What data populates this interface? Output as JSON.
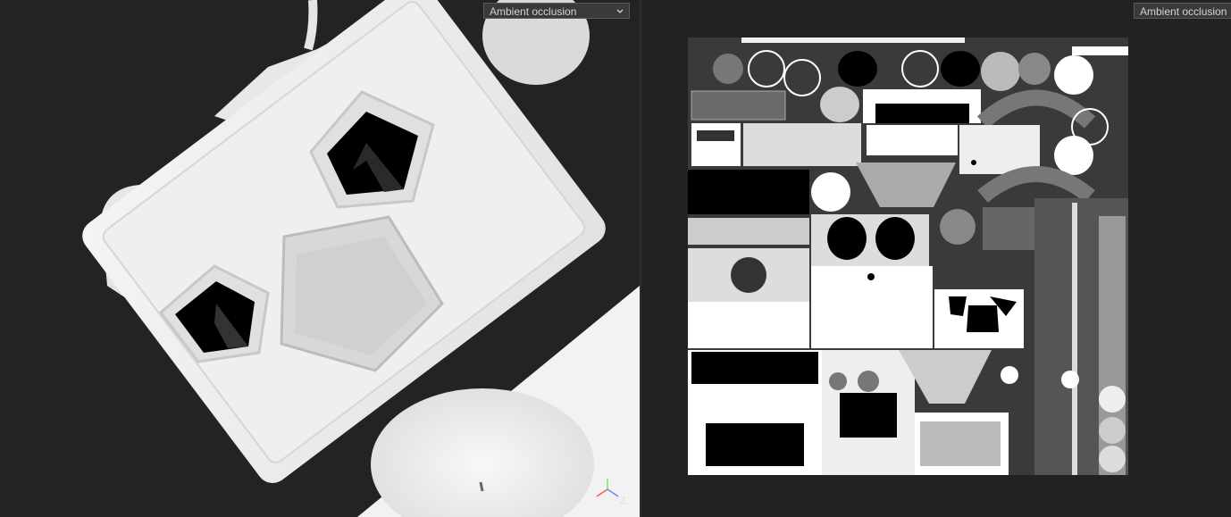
{
  "viewport_3d": {
    "channel_select": {
      "value": "Ambient occlusion",
      "icon": "chevron-down-icon"
    },
    "axis_gizmo": {
      "label": "Z",
      "icon": "axis-gizmo-icon"
    }
  },
  "viewport_uv": {
    "channel_select": {
      "value": "Ambient occlusion"
    }
  },
  "colors": {
    "background": "#232323",
    "dropdown_bg": "#3a3a3a",
    "dropdown_text": "#d4d4d4",
    "gizmo_x": "#ff5555",
    "gizmo_y": "#55ff55",
    "gizmo_z": "#6688ff"
  }
}
